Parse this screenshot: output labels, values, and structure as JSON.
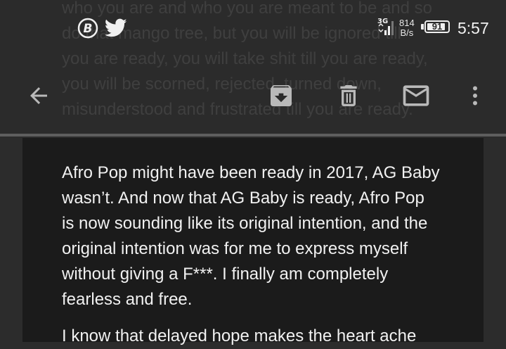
{
  "background_text": {
    "lines": [
      "who you are and who you are meant to be and so",
      "do that mango tree, but you will be ignored till",
      "you are ready, you will take shit till you are ready,",
      "you will be scorned, rejected, turned down,",
      "misunderstood and frustrated till you are ready."
    ]
  },
  "status_bar": {
    "network_type": "3G",
    "net_speed_value": "814",
    "net_speed_unit": "B/s",
    "battery_level": "91",
    "battery_fraction": 0.91,
    "time": "5:57"
  },
  "toolbar": {
    "icons": [
      "back-arrow-icon",
      "archive-icon",
      "delete-icon",
      "mail-icon",
      "more-vert-icon"
    ]
  },
  "article": {
    "paragraph1": [
      "Afro Pop might have been ready in 2017, AG Baby",
      "wasn’t. And now that AG Baby is ready, Afro Pop",
      "is now sounding like its original intention, and the",
      "original intention was for me to express myself",
      "without giving a F***. I finally am completely",
      "fearless and free."
    ],
    "paragraph2": [
      "I know that delayed hope makes the heart ache"
    ]
  },
  "colors": {
    "background": "#2c2c2c",
    "card": "#1b1b1b",
    "text": "#f1f1f1",
    "icon": "#b9b9b9"
  }
}
